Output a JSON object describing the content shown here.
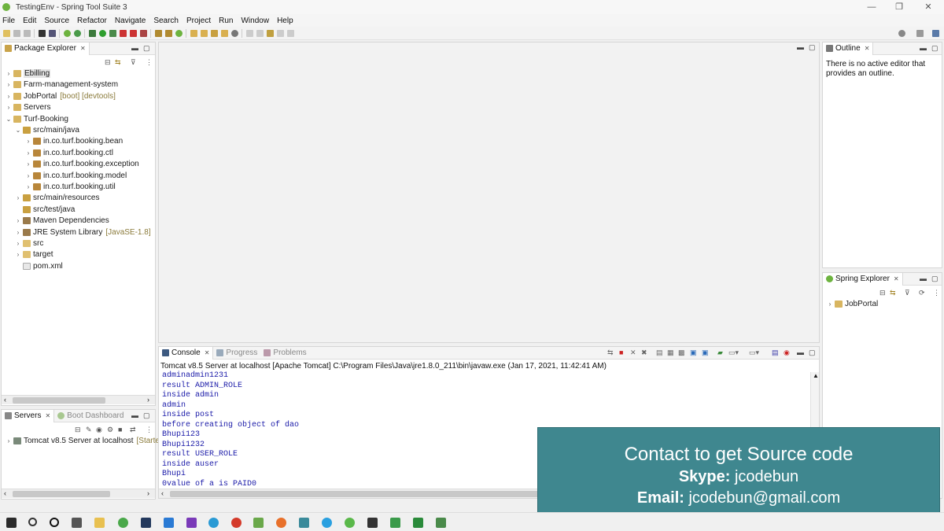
{
  "window": {
    "title": "TestingEnv - Spring Tool Suite 3",
    "controls": {
      "minimize": "—",
      "restore": "❐",
      "close": "✕"
    }
  },
  "menubar": [
    "File",
    "Edit",
    "Source",
    "Refactor",
    "Navigate",
    "Search",
    "Project",
    "Run",
    "Window",
    "Help"
  ],
  "package_explorer": {
    "tab": "Package Explorer",
    "projects": [
      {
        "label": "Ebilling",
        "expanded": false
      },
      {
        "label": "Farm-management-system",
        "expanded": false
      },
      {
        "label": "JobPortal",
        "decoration": "[boot] [devtools]",
        "expanded": false
      },
      {
        "label": "Servers",
        "expanded": false
      },
      {
        "label": "Turf-Booking",
        "expanded": true
      }
    ],
    "turf_children": [
      {
        "label": "src/main/java",
        "expanded": true
      },
      {
        "label": "in.co.turf.booking.bean"
      },
      {
        "label": "in.co.turf.booking.ctl"
      },
      {
        "label": "in.co.turf.booking.exception"
      },
      {
        "label": "in.co.turf.booking.model"
      },
      {
        "label": "in.co.turf.booking.util"
      },
      {
        "label": "src/main/resources"
      },
      {
        "label": "src/test/java"
      },
      {
        "label": "Maven Dependencies"
      },
      {
        "label": "JRE System Library",
        "decoration": "[JavaSE-1.8]"
      },
      {
        "label": "src"
      },
      {
        "label": "target"
      },
      {
        "label": "pom.xml"
      }
    ]
  },
  "servers_view": {
    "tabs": [
      "Servers",
      "Boot Dashboard"
    ],
    "items": [
      {
        "label": "Tomcat v8.5 Server at localhost",
        "status": "[Started"
      }
    ]
  },
  "outline": {
    "tab": "Outline",
    "message": "There is no active editor that provides an outline."
  },
  "spring_explorer": {
    "tab": "Spring Explorer",
    "items": [
      "JobPortal"
    ]
  },
  "console": {
    "tabs": [
      "Console",
      "Progress",
      "Problems"
    ],
    "header": "Tomcat v8.5 Server at localhost [Apache Tomcat] C:\\Program Files\\Java\\jre1.8.0_211\\bin\\javaw.exe  (Jan 17, 2021, 11:42:41 AM)",
    "lines": [
      "adminadmin1231",
      "result ADMIN_ROLE",
      "inside admin",
      "admin",
      "inside post",
      "before creating object of dao",
      "Bhupi123",
      "Bhupi1232",
      "result USER_ROLE",
      "inside auser",
      "Bhupi",
      "0value of a is PAID0"
    ]
  },
  "overlay": {
    "line1": "Contact to get Source code",
    "skype_label": "Skype:",
    "skype_value": "jcodebun",
    "email_label": "Email:",
    "email_value": "jcodebun@gmail.com"
  },
  "colors": {
    "overlay_bg": "#3f878f",
    "console_text": "#1a1aa8",
    "decoration": "#8a7a3a"
  }
}
